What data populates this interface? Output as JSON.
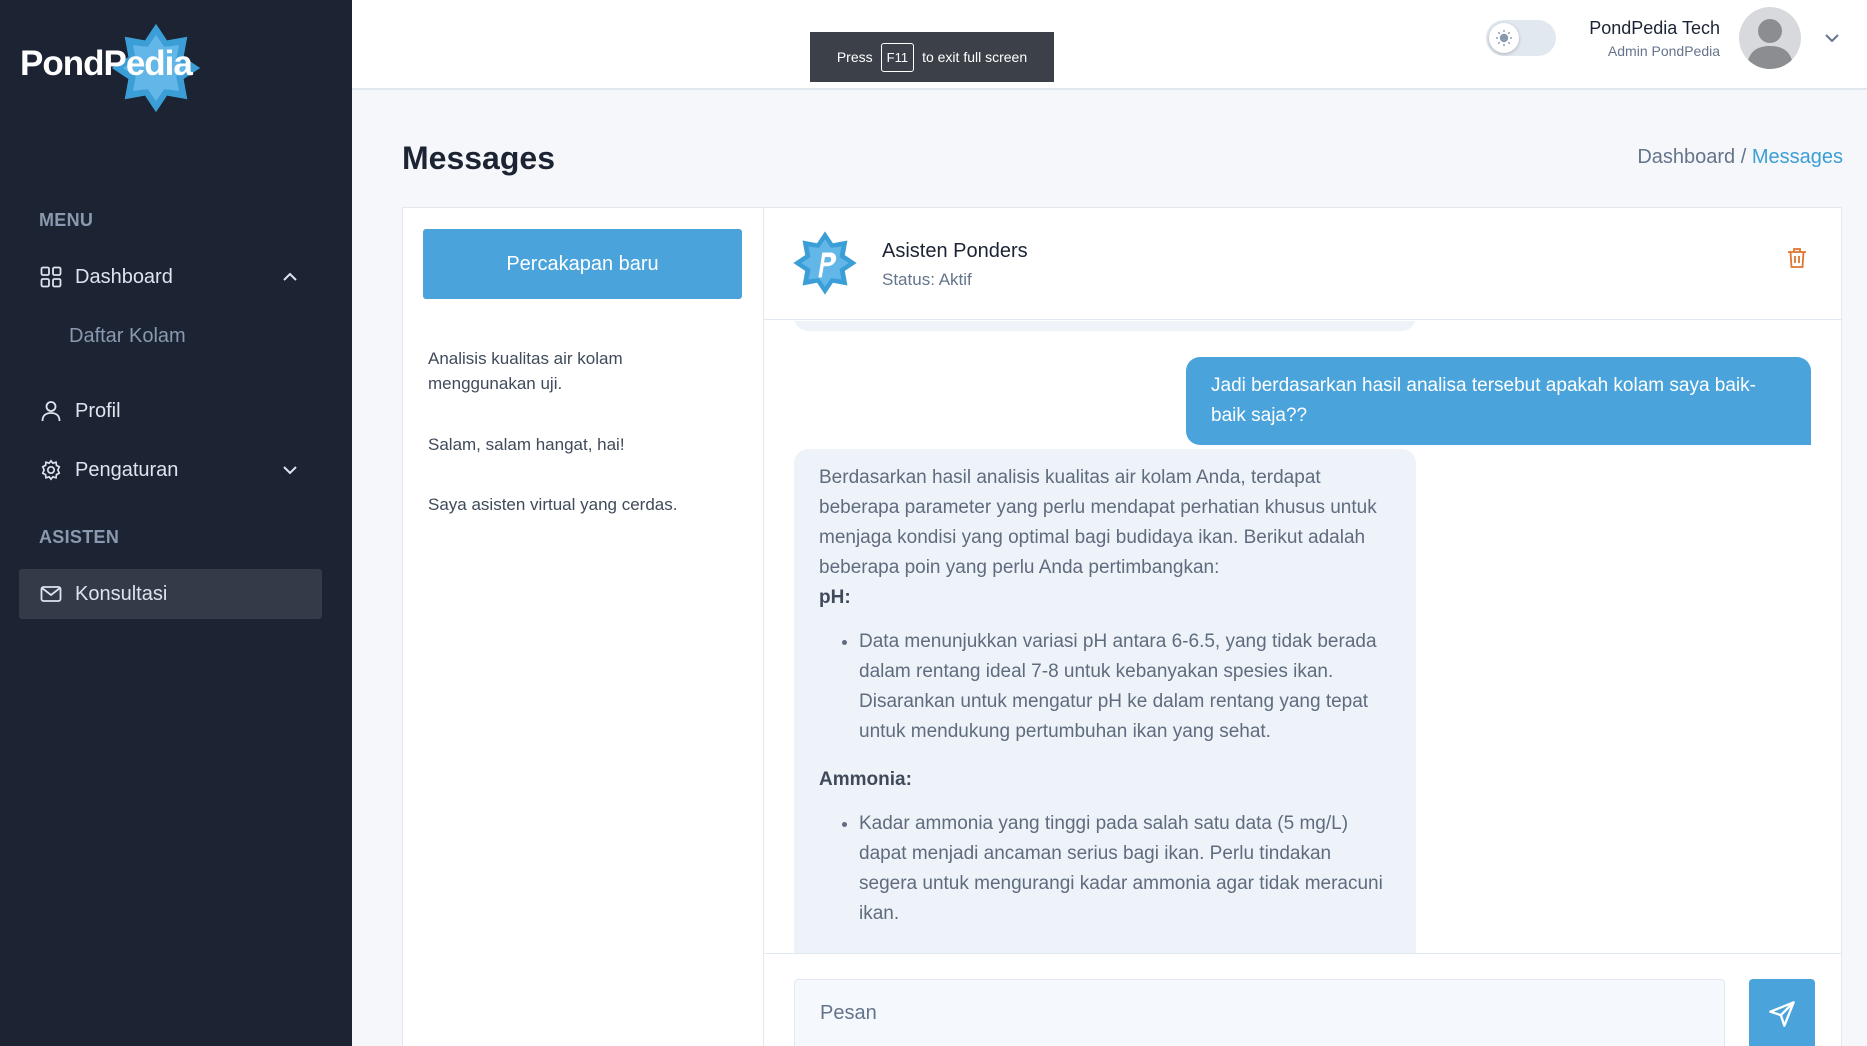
{
  "brand": {
    "logo_text": "PondPedia",
    "accent": "#4aa3db",
    "sidebar_bg": "#1c2434"
  },
  "sidebar": {
    "menu_heading": "MENU",
    "dashboard": {
      "label": "Dashboard",
      "icon": "grid-icon",
      "submenu": [
        "Daftar Kolam"
      ]
    },
    "profil": {
      "label": "Profil",
      "icon": "user-icon"
    },
    "pengaturan": {
      "label": "Pengaturan",
      "icon": "gear-icon"
    },
    "asisten_heading": "ASISTEN",
    "konsultasi": {
      "label": "Konsultasi",
      "icon": "mail-icon"
    }
  },
  "header": {
    "fullscreen_notice": {
      "press": "Press",
      "key": "F11",
      "rest": "to exit full screen"
    },
    "user_name": "PondPedia Tech",
    "user_role": "Admin PondPedia"
  },
  "page": {
    "title": "Messages",
    "breadcrumb": {
      "parent": "Dashboard /",
      "current": "Messages"
    }
  },
  "conversations": {
    "new_button": "Percakapan baru",
    "items": [
      "Analisis kualitas air kolam menggunakan uji.",
      "Salam, salam hangat, hai!",
      "Saya asisten virtual yang cerdas."
    ]
  },
  "chat": {
    "bot_name": "Asisten Ponders",
    "bot_status": "Status: Aktif",
    "user_message": "Jadi berdasarkan hasil analisa tersebut apakah kolam saya baik-baik saja??",
    "bot_message": {
      "intro": "Berdasarkan hasil analisis kualitas air kolam Anda, terdapat beberapa parameter yang perlu mendapat perhatian khusus untuk menjaga kondisi yang optimal bagi budidaya ikan. Berikut adalah beberapa poin yang perlu Anda pertimbangkan:",
      "ph_heading": "pH:",
      "ph_point": "Data menunjukkan variasi pH antara 6-6.5, yang tidak berada dalam rentang ideal 7-8 untuk kebanyakan spesies ikan. Disarankan untuk mengatur pH ke dalam rentang yang tepat untuk mendukung pertumbuhan ikan yang sehat.",
      "ammonia_heading": "Ammonia:",
      "ammonia_point": "Kadar ammonia yang tinggi pada salah satu data (5 mg/L) dapat menjadi ancaman serius bagi ikan. Perlu tindakan segera untuk mengurangi kadar ammonia agar tidak meracuni ikan."
    },
    "input_placeholder": "Pesan"
  }
}
